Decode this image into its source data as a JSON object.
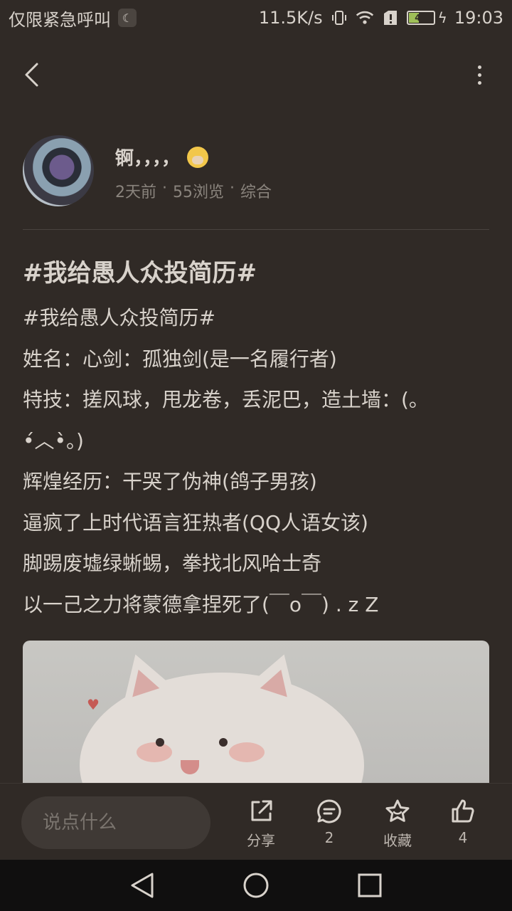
{
  "status_bar": {
    "left_text": "仅限紧急呼叫",
    "network_speed": "11.5K/s",
    "battery_level": "41",
    "time": "19:03"
  },
  "post": {
    "author_name": "锕，，，，",
    "time_ago": "2天前",
    "views": "55浏览",
    "category": "综合",
    "meta_sep": "·",
    "title": "#我给愚人众投简历#",
    "lines": [
      "#我给愚人众投简历#",
      "姓名：心剑：孤独剑(是一名履行者)",
      "特技：搓风球，甩龙卷，丢泥巴，造土墙：(。",
      "•́︿•̀。)",
      "辉煌经历：干哭了伪神(鸽子男孩)",
      "逼疯了上时代语言狂热者(QQ人语女该)",
      "脚踢废墟绿蜥蜴，拳找北风哈士奇",
      "以一己之力将蒙德拿捏死了(￣o￣) . z Z"
    ]
  },
  "bottom_bar": {
    "comment_placeholder": "说点什么",
    "share_label": "分享",
    "comment_count": "2",
    "favorite_label": "收藏",
    "like_count": "4"
  },
  "icons": {
    "back": "back-arrow-icon",
    "more": "more-vertical-icon",
    "share": "share-icon",
    "comment": "comment-icon",
    "favorite": "star-icon",
    "like": "thumbs-up-icon"
  },
  "colors": {
    "background": "#302a26",
    "text": "#d8d2cb",
    "muted": "#8a847d"
  }
}
